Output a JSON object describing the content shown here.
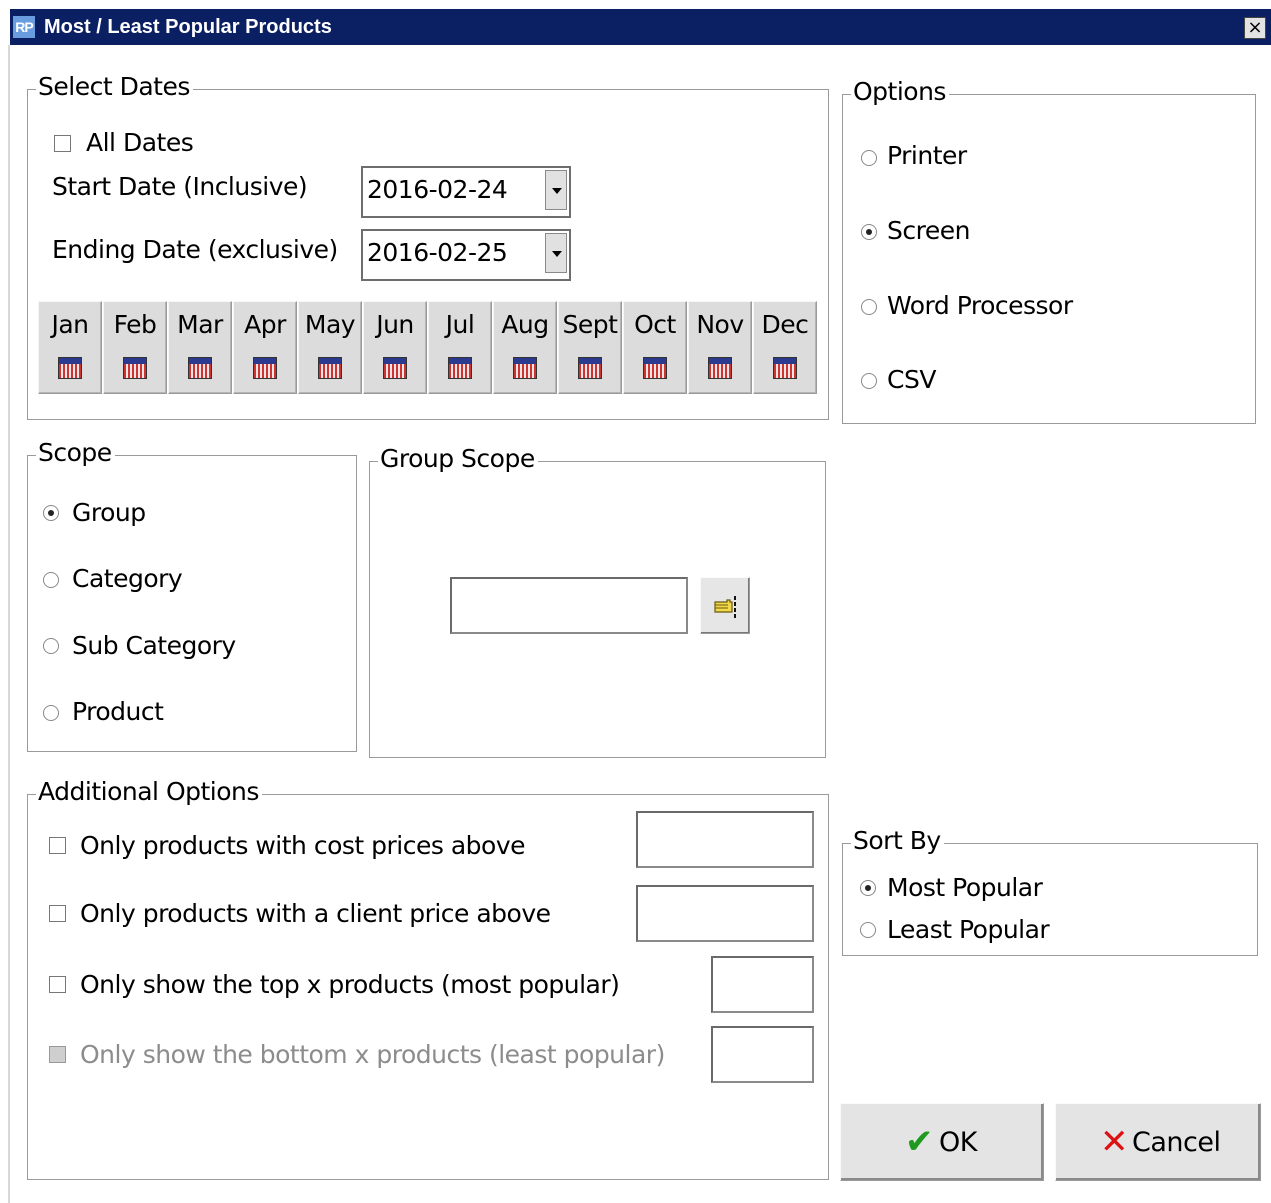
{
  "window": {
    "app_icon_text": "RP",
    "title": "Most / Least Popular Products",
    "close_glyph": "×"
  },
  "select_dates": {
    "legend": "Select Dates",
    "all_dates_label": "All Dates",
    "all_dates_checked": false,
    "start_label": "Start Date (Inclusive)",
    "start_value": "2016-02-24",
    "end_label": "Ending Date (exclusive)",
    "end_value": "2016-02-25",
    "months": [
      "Jan",
      "Feb",
      "Mar",
      "Apr",
      "May",
      "Jun",
      "Jul",
      "Aug",
      "Sept",
      "Oct",
      "Nov",
      "Dec"
    ]
  },
  "options": {
    "legend": "Options",
    "items": [
      "Printer",
      "Screen",
      "Word Processor",
      "CSV"
    ],
    "selected": "Screen"
  },
  "scope": {
    "legend": "Scope",
    "items": [
      "Group",
      "Category",
      "Sub Category",
      "Product"
    ],
    "selected": "Group"
  },
  "group_scope": {
    "legend": "Group Scope",
    "value": "",
    "lookup_icon": "pointing-hand-icon"
  },
  "additional_options": {
    "legend": "Additional Options",
    "items": [
      {
        "label": "Only products with cost prices above",
        "checked": false,
        "enabled": true,
        "value": ""
      },
      {
        "label": "Only products with a client price above",
        "checked": false,
        "enabled": true,
        "value": ""
      },
      {
        "label": "Only show the top x  products (most popular)",
        "checked": false,
        "enabled": true,
        "value": ""
      },
      {
        "label": "Only show the bottom x products (least popular)",
        "checked": false,
        "enabled": false,
        "value": ""
      }
    ]
  },
  "sort_by": {
    "legend": "Sort By",
    "items": [
      "Most Popular",
      "Least Popular"
    ],
    "selected": "Most Popular"
  },
  "buttons": {
    "ok_label": "OK",
    "ok_icon": "checkmark-icon",
    "cancel_label": "Cancel",
    "cancel_icon": "x-icon"
  },
  "colors": {
    "titlebar": "#0b1f63",
    "ok_check": "#1f9a1f",
    "cancel_x": "#dd1111"
  }
}
